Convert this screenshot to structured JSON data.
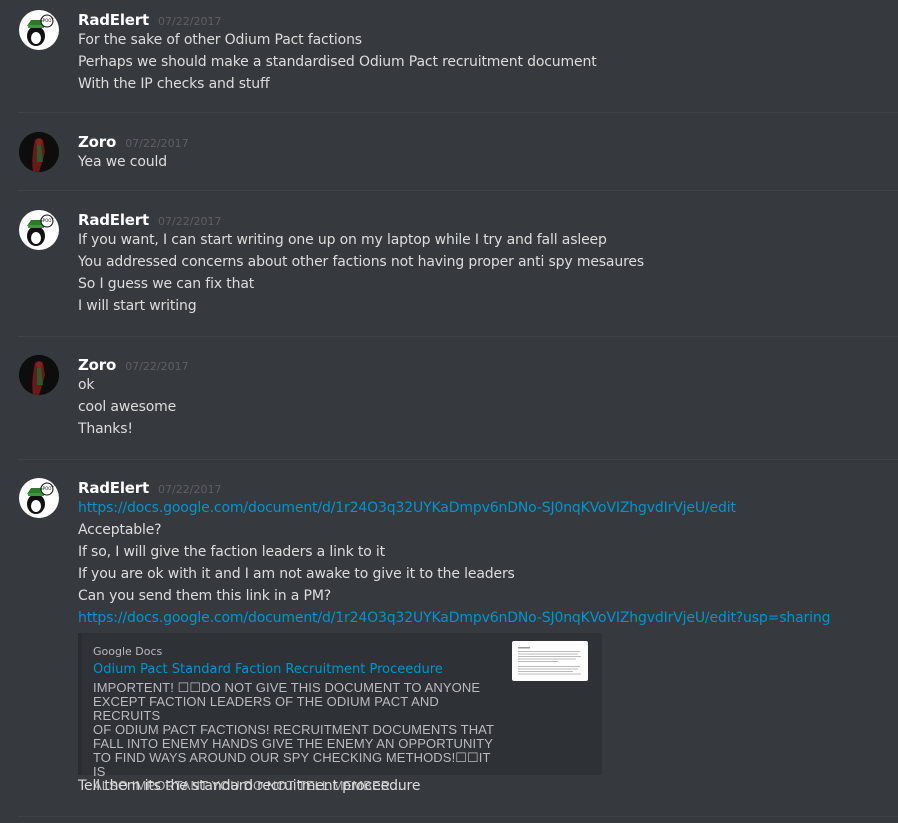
{
  "messages": [
    {
      "author": "RadElert",
      "timestamp": "07/22/2017",
      "lines": [
        "For the sake of other Odium Pact factions",
        "Perhaps we should make a standardised Odium Pact recruitment document",
        "With the IP checks and stuff"
      ]
    },
    {
      "author": "Zoro",
      "timestamp": "07/22/2017",
      "lines": [
        "Yea we could"
      ]
    },
    {
      "author": "RadElert",
      "timestamp": "07/22/2017",
      "lines": [
        "If you want, I can start writing one up on my laptop while I try and fall asleep",
        "You addressed concerns about other factions not having proper anti spy mesaures",
        "So I guess we can fix that",
        "I will start writing"
      ]
    },
    {
      "author": "Zoro",
      "timestamp": "07/22/2017",
      "lines": [
        "ok",
        "cool awesome",
        "Thanks!"
      ]
    },
    {
      "author": "RadElert",
      "timestamp": "07/22/2017",
      "lines": [
        "https://docs.google.com/document/d/1r24O3q32UYKaDmpv6nDNo-SJ0nqKVoVIZhgvdIrVjeU/edit",
        "Acceptable?",
        "If so, I will give the faction leaders a link to it",
        "If you are ok with it and I am not awake to give it to the leaders",
        "Can you send them this link in a PM?",
        "https://docs.google.com/document/d/1r24O3q32UYKaDmpv6nDNo-SJ0nqKVoVIZhgvdIrVjeU/edit?usp=sharing"
      ],
      "embed": {
        "provider": "Google Docs",
        "title": "Odium Pact Standard Faction Recruitment Proceedure",
        "description_lines": [
          "IMPORTENT! ☐☐DO NOT GIVE THIS DOCUMENT TO ANYONE",
          "EXCEPT FACTION LEADERS OF THE ODIUM PACT AND RECRUITS",
          "OF ODIUM PACT FACTIONS! RECRUITMENT DOCUMENTS THAT",
          "FALL INTO ENEMY HANDS GIVE THE ENEMY AN OPPORTUNITY",
          "TO FIND WAYS AROUND OUR SPY CHECKING METHODS!☐☐IT IS",
          "ALSO IMPORTANT YOU DO NOT TELL MEMBER..."
        ]
      },
      "after_embed": "Tell them its the standard recruitment proceedure"
    }
  ],
  "colors": {
    "background": "#36393e",
    "link": "#0096cf",
    "author": "#ffffff",
    "timestamp": "#5d5f64",
    "text": "#dcddde"
  }
}
